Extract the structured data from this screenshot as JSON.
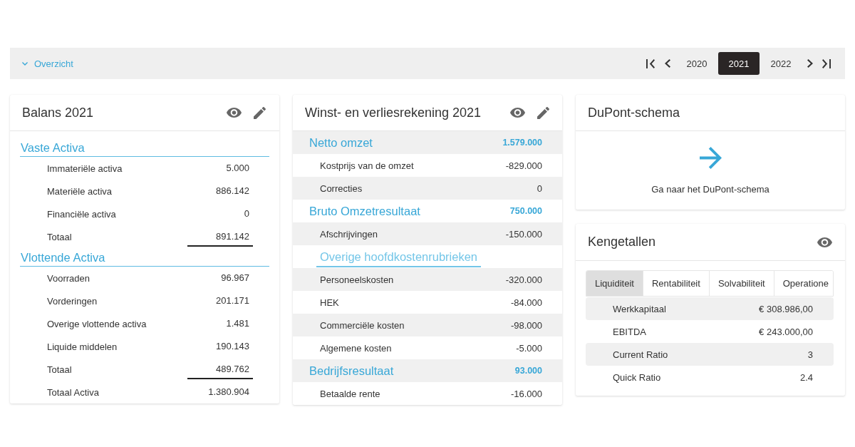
{
  "toolbar": {
    "overview": {
      "label": "Overzicht",
      "expanded": true
    },
    "years": [
      {
        "label": "2020",
        "selected": false
      },
      {
        "label": "2021",
        "selected": true
      },
      {
        "label": "2022",
        "selected": false
      }
    ]
  },
  "balance": {
    "title": "Balans 2021",
    "sections": [
      {
        "title": "Vaste Activa",
        "rows": [
          {
            "kind": "item",
            "label": "Immateriële activa",
            "value": "5.000"
          },
          {
            "kind": "item",
            "label": "Materiële activa",
            "value": "886.142"
          },
          {
            "kind": "item",
            "label": "Financiële activa",
            "value": "0"
          },
          {
            "kind": "total",
            "label": "Totaal",
            "value": "891.142"
          }
        ]
      },
      {
        "title": "Vlottende Activa",
        "rows": [
          {
            "kind": "item",
            "label": "Voorraden",
            "value": "96.967"
          },
          {
            "kind": "item",
            "label": "Vorderingen",
            "value": "201.171"
          },
          {
            "kind": "item",
            "label": "Overige vlottende activa",
            "value": "1.481"
          },
          {
            "kind": "item",
            "label": "Liquide middelen",
            "value": "190.143"
          },
          {
            "kind": "total",
            "label": "Totaal",
            "value": "489.762"
          }
        ]
      }
    ],
    "grand_total": {
      "label": "Totaal Activa",
      "value": "1.380.904"
    }
  },
  "income_statement": {
    "title": "Winst- en verliesrekening 2021",
    "rows": [
      {
        "kind": "section",
        "label": "Netto omzet",
        "value": "1.579.000"
      },
      {
        "kind": "item",
        "label": "Kostprijs van de omzet",
        "value": "-829.000"
      },
      {
        "kind": "item",
        "label": "Correcties",
        "value": "0"
      },
      {
        "kind": "section",
        "label": "Bruto Omzetresultaat",
        "value": "750.000"
      },
      {
        "kind": "item",
        "label": "Afschrijvingen",
        "value": "-150.000"
      },
      {
        "kind": "group",
        "label": "Overige hoofdkostenrubrieken"
      },
      {
        "kind": "item",
        "label": "Personeelskosten",
        "value": "-320.000"
      },
      {
        "kind": "item",
        "label": "HEK",
        "value": "-84.000"
      },
      {
        "kind": "item",
        "label": "Commerciële kosten",
        "value": "-98.000"
      },
      {
        "kind": "item",
        "label": "Algemene kosten",
        "value": "-5.000"
      },
      {
        "kind": "section",
        "label": "Bedrijfsresultaat",
        "value": "93.000"
      },
      {
        "kind": "item",
        "label": "Betaalde rente",
        "value": "-16.000"
      }
    ]
  },
  "dupont": {
    "title": "DuPont-schema",
    "link": "Ga naar het DuPont-schema"
  },
  "ratios": {
    "title": "Kengetallen",
    "tabs": [
      {
        "label": "Liquiditeit",
        "selected": true
      },
      {
        "label": "Rentabiliteit",
        "selected": false
      },
      {
        "label": "Solvabiliteit",
        "selected": false
      },
      {
        "label": "Operatione",
        "selected": false
      }
    ],
    "rows": [
      {
        "label": "Werkkapitaal",
        "value": "€ 308.986,00"
      },
      {
        "label": "EBITDA",
        "value": "€ 243.000,00"
      },
      {
        "label": "Current Ratio",
        "value": "3"
      },
      {
        "label": "Quick Ratio",
        "value": "2.4"
      }
    ]
  }
}
